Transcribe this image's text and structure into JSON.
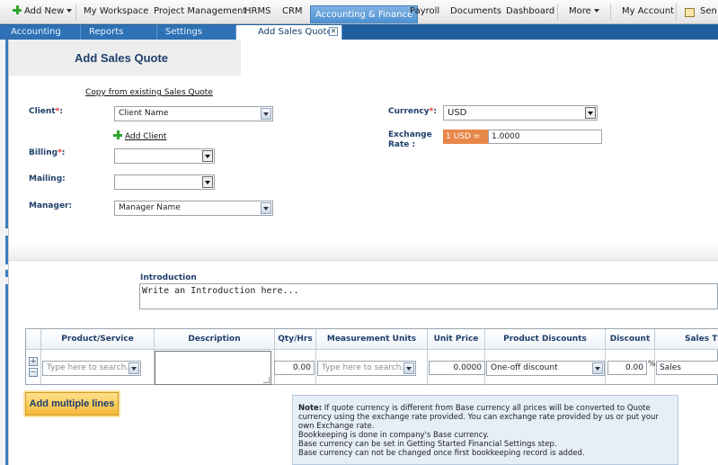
{
  "topnav": {
    "add_new": "Add New",
    "items": [
      "My Workspace",
      "Project Management",
      "HRMS",
      "CRM",
      "Accounting & Finance",
      "Payroll",
      "Documents",
      "Dashboard",
      "More",
      "My Account",
      "Sen"
    ],
    "active_index": 4
  },
  "subnav": {
    "tabs": [
      "Accounting",
      "Reports",
      "Settings",
      "Add Sales Quote"
    ],
    "close_symbol": "✕"
  },
  "page": {
    "title": "Add Sales Quote",
    "copy_link": "Copy from existing Sales Quote"
  },
  "form": {
    "client_label": "Client",
    "client_value": "Client Name",
    "add_client": "Add Client",
    "billing_label": "Billing",
    "billing_value": "",
    "mailing_label": "Mailing:",
    "mailing_value": "",
    "manager_label": "Manager:",
    "manager_value": "Manager Name",
    "currency_label": "Currency",
    "currency_value": "USD",
    "exchange_label": "Exchange",
    "exchange_label_2": "Rate :",
    "rate_prefix": "1 USD =",
    "rate_value": "1.0000",
    "required_mark": "*",
    "colon": ":"
  },
  "intro": {
    "label": "Introduction",
    "placeholder": "Write an Introduction here..."
  },
  "grid": {
    "headers": [
      "Product/Service",
      "Description",
      "Qty/Hrs",
      "Measurement Units",
      "Unit Price",
      "Product Discounts",
      "Discount",
      "Sales T"
    ],
    "row": {
      "product_placeholder": "Type here to search...",
      "description": "",
      "qty": "0.00",
      "units_placeholder": "Type here to search...",
      "unit_price": "0.0000",
      "product_discount": "One-off discount",
      "discount": "0.00",
      "discount_unit": "%",
      "sales_tax": "Sales"
    },
    "add_row": "+",
    "remove_row": "−"
  },
  "actions": {
    "add_multiple": "Add multiple lines"
  },
  "note": {
    "title": "Note:",
    "line1": "If quote currency is different from Base currency all prices will be converted to Quote currency using the exchange rate provided. You can exchange rate provided by us or put your own Exchange rate.",
    "line2": "Bookkeeping is done in company's Base currency.",
    "line3": "Base currency can be set in Getting Started Financial Settings step.",
    "line4": "Base currency can not be changed once first bookkeeping record is added."
  },
  "colors": {
    "accent": "#5b9bd5",
    "navy": "#1f3f6b",
    "orange": "#e8874a",
    "button": "#f5b93a"
  }
}
